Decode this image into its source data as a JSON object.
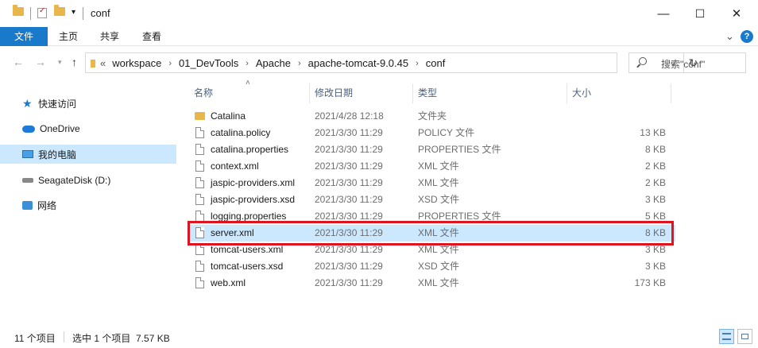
{
  "window": {
    "title": "conf",
    "minimize": "—",
    "maximize": "☐",
    "close": "✕"
  },
  "ribbon": {
    "tabs": [
      "文件",
      "主页",
      "共享",
      "查看"
    ],
    "expand": "⌄"
  },
  "address": {
    "overflow": "«",
    "crumbs": [
      "workspace",
      "01_DevTools",
      "Apache",
      "apache-tomcat-9.0.45",
      "conf"
    ],
    "separator": "›"
  },
  "search": {
    "placeholder": "搜索\"conf\""
  },
  "sidebar": {
    "items": [
      {
        "label": "快速访问",
        "icon": "star-icon"
      },
      {
        "label": "OneDrive",
        "icon": "cloud-icon"
      },
      {
        "label": "我的电脑",
        "icon": "computer-icon",
        "selected": true
      },
      {
        "label": "SeagateDisk (D:)",
        "icon": "drive-icon"
      },
      {
        "label": "网络",
        "icon": "network-icon"
      }
    ]
  },
  "columns": {
    "name": "名称",
    "modified": "修改日期",
    "type": "类型",
    "size": "大小"
  },
  "files": [
    {
      "name": "Catalina",
      "modified": "2021/4/28 12:18",
      "type": "文件夹",
      "size": "",
      "kind": "folder"
    },
    {
      "name": "catalina.policy",
      "modified": "2021/3/30 11:29",
      "type": "POLICY 文件",
      "size": "13 KB",
      "kind": "file"
    },
    {
      "name": "catalina.properties",
      "modified": "2021/3/30 11:29",
      "type": "PROPERTIES 文件",
      "size": "8 KB",
      "kind": "file"
    },
    {
      "name": "context.xml",
      "modified": "2021/3/30 11:29",
      "type": "XML 文件",
      "size": "2 KB",
      "kind": "file"
    },
    {
      "name": "jaspic-providers.xml",
      "modified": "2021/3/30 11:29",
      "type": "XML 文件",
      "size": "2 KB",
      "kind": "file"
    },
    {
      "name": "jaspic-providers.xsd",
      "modified": "2021/3/30 11:29",
      "type": "XSD 文件",
      "size": "3 KB",
      "kind": "file"
    },
    {
      "name": "logging.properties",
      "modified": "2021/3/30 11:29",
      "type": "PROPERTIES 文件",
      "size": "5 KB",
      "kind": "file"
    },
    {
      "name": "server.xml",
      "modified": "2021/3/30 11:29",
      "type": "XML 文件",
      "size": "8 KB",
      "kind": "file",
      "selected": true
    },
    {
      "name": "tomcat-users.xml",
      "modified": "2021/3/30 11:29",
      "type": "XML 文件",
      "size": "3 KB",
      "kind": "file"
    },
    {
      "name": "tomcat-users.xsd",
      "modified": "2021/3/30 11:29",
      "type": "XSD 文件",
      "size": "3 KB",
      "kind": "file"
    },
    {
      "name": "web.xml",
      "modified": "2021/3/30 11:29",
      "type": "XML 文件",
      "size": "173 KB",
      "kind": "file"
    }
  ],
  "status": {
    "count": "11 个项目",
    "selection": "选中 1 个项目  7.57 KB"
  },
  "colors": {
    "accent": "#1979ca",
    "selection": "#cce8ff",
    "highlight": "#e0141e"
  }
}
